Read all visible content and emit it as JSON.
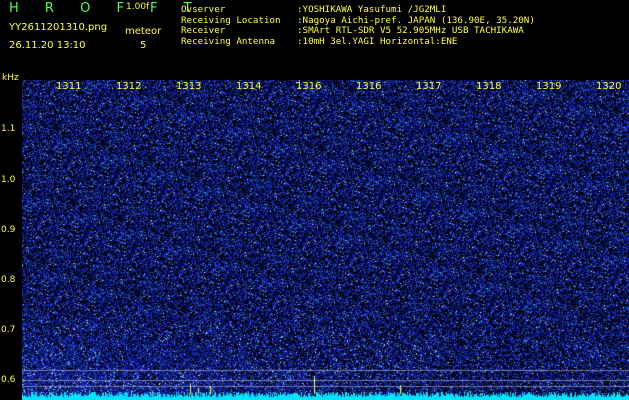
{
  "header": {
    "brand": "H R O F F T",
    "version": "1.00f",
    "filename": "YY2611201310.png",
    "datetime": "26.11.20 13:10",
    "event_type": "meteor",
    "event_count": "5"
  },
  "station_info": [
    {
      "key": "Ovserver",
      "value": ":YOSHIKAWA Yasufumi /JG2MLI"
    },
    {
      "key": "Receiving Location",
      "value": ":Nagoya Aichi-pref. JAPAN (136.90E, 35.20N)"
    },
    {
      "key": "Receiver",
      "value": ":SMArt RTL-SDR V5 52.905MHz USB TACHIKAWA"
    },
    {
      "key": "Receiving Antenna",
      "value": ":10mH 3el.YAGI Horizontal:ENE"
    }
  ],
  "plot": {
    "y_unit": "kHz",
    "y_ticks": [
      "1.1",
      "1.0",
      "0.9",
      "0.8",
      "0.7",
      "0.6"
    ],
    "x_ticks": [
      "1311",
      "1312",
      "1313",
      "1314",
      "1316",
      "1316",
      "1317",
      "1318",
      "1319",
      "1320"
    ]
  },
  "colors": {
    "background": "#000000",
    "text": "#ffff33",
    "brand": "#4cff4c",
    "noise_deep": "#0a1a8c",
    "noise_bright": "#5aa0ff",
    "baseline": "#00e5ff",
    "meteor_echo": "#ffff33"
  }
}
